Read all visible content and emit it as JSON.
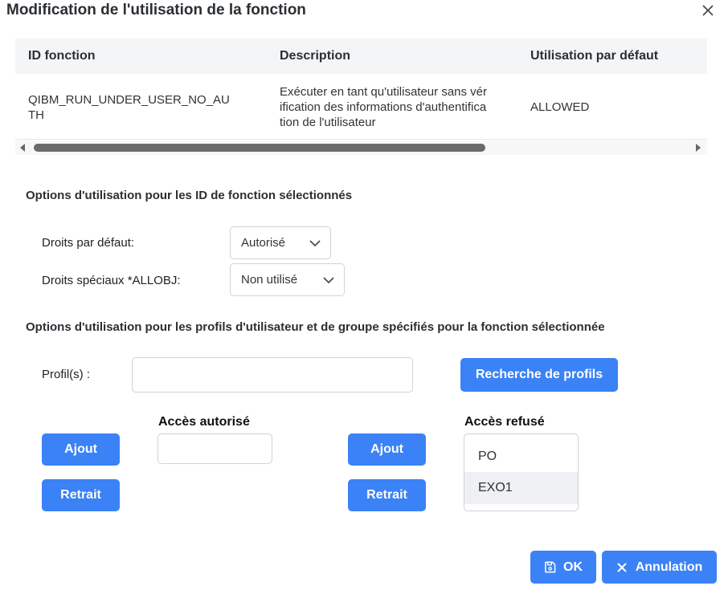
{
  "dialog": {
    "title": "Modification de l'utilisation de la fonction"
  },
  "table": {
    "headers": [
      "ID fonction",
      "Description",
      "Utilisation par défaut"
    ],
    "row": {
      "id_line1": "QIBM_RUN_UNDER_USER_NO_AU",
      "id_line2": "TH",
      "desc_line1": "Exécuter en tant qu'utilisateur sans vér",
      "desc_line2": "ification des informations d'authentifica",
      "desc_line3": "tion de l'utilisateur",
      "usage": "ALLOWED"
    }
  },
  "options": {
    "section_title": "Options d'utilisation pour les ID de fonction sélectionnés",
    "default_rights_label": "Droits par défaut:",
    "default_rights_value": "Autorisé",
    "allobj_label": "Droits spéciaux *ALLOBJ:",
    "allobj_value": "Non utilisé"
  },
  "profiles": {
    "section_title": "Options d'utilisation pour les profils d'utilisateur et de groupe spécifiés pour la fonction sélectionnée",
    "profile_label": "Profil(s) :",
    "profile_value": "",
    "search_button": "Recherche de profils",
    "allowed_title": "Accès autorisé",
    "denied_title": "Accès refusé",
    "add_label": "Ajout",
    "remove_label": "Retrait",
    "allowed_value": "",
    "denied_items": [
      "PO",
      "EXO1"
    ]
  },
  "footer": {
    "ok_label": "OK",
    "cancel_label": "Annulation"
  },
  "colors": {
    "accent": "#3b82f6",
    "header_bg": "#f4f5f7",
    "selected_row": "#eef0f3"
  }
}
